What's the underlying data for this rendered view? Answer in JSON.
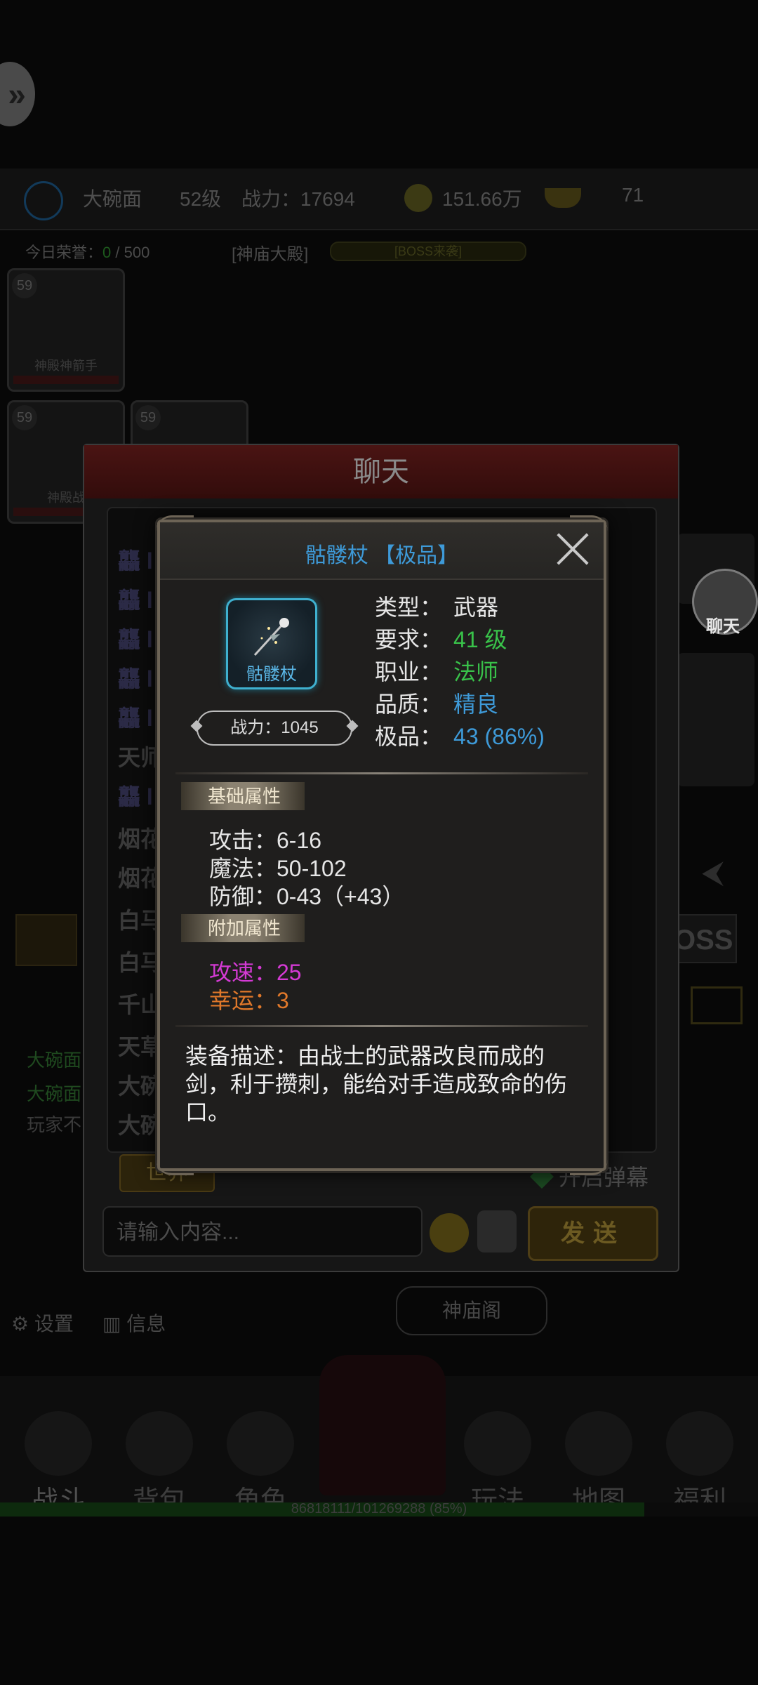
{
  "background": {
    "player_name": "大碗面",
    "player_level": "52级",
    "combat_power_label": "战力：17694",
    "gold": "151.66万",
    "ingots": "71",
    "honor_label": "今日荣誉：",
    "honor_current": "0",
    "honor_max": "/ 500",
    "location": "[神庙大殿]",
    "boss_bar_text": "[BOSS来袭]",
    "cards": [
      {
        "level": "59",
        "name": "神殿神箭手"
      },
      {
        "level": "59",
        "name": "神殿战"
      },
      {
        "level": "59",
        "name": ""
      }
    ],
    "left_log": [
      "大碗面",
      "大碗面",
      "玩家不"
    ],
    "boss_side": "OSS",
    "settings_label": "设置",
    "info_label": "信息",
    "temple_tag": "神庙阁",
    "nav": [
      "战斗",
      "背包",
      "角色",
      "玩法",
      "地图",
      "福利"
    ],
    "exp_text": "86818111/101269288 (85%)",
    "exp_fraction": 0.85
  },
  "chat": {
    "title": "聊天",
    "lines": [
      "龘 l",
      "龘 l",
      "龘 l",
      "龘 l",
      "龘 l",
      "天师",
      "龘 l",
      "烟花",
      "烟花",
      "白马",
      "白马",
      "千山",
      "天草",
      "大碗",
      "大碗"
    ],
    "world_tab": "世界",
    "danmu_label": "开启弹幕",
    "input_placeholder": "请输入内容...",
    "send_label": "发送",
    "fab_label": "聊天"
  },
  "item": {
    "title": "骷髅杖 【极品】",
    "icon_label": "骷髅杖",
    "icon_name": "staff-icon",
    "power": "战力：1045",
    "attrs": [
      {
        "label": "类型：",
        "value": "武器"
      },
      {
        "label": "要求：",
        "value": "41 级"
      },
      {
        "label": "职业：",
        "value": "法师"
      },
      {
        "label": "品质：",
        "value": "精良"
      },
      {
        "label": "极品：",
        "value": "43 (86%)"
      }
    ],
    "basic_section": "基础属性",
    "basic_stats": [
      "攻击：6-16",
      "魔法：50-102",
      "防御：0-43（+43）"
    ],
    "extra_section": "附加属性",
    "extra_stats": [
      "攻速：25",
      "幸运：3"
    ],
    "description": "装备描述：由战士的武器改良而成的剑，利于攒刺，能给对手造成致命的伤口。",
    "colors": {
      "title": "#3e9ad8",
      "green": "#39c24a",
      "blue": "#3e9ad8",
      "pink": "#d43ad4",
      "orange": "#e0782a"
    }
  }
}
